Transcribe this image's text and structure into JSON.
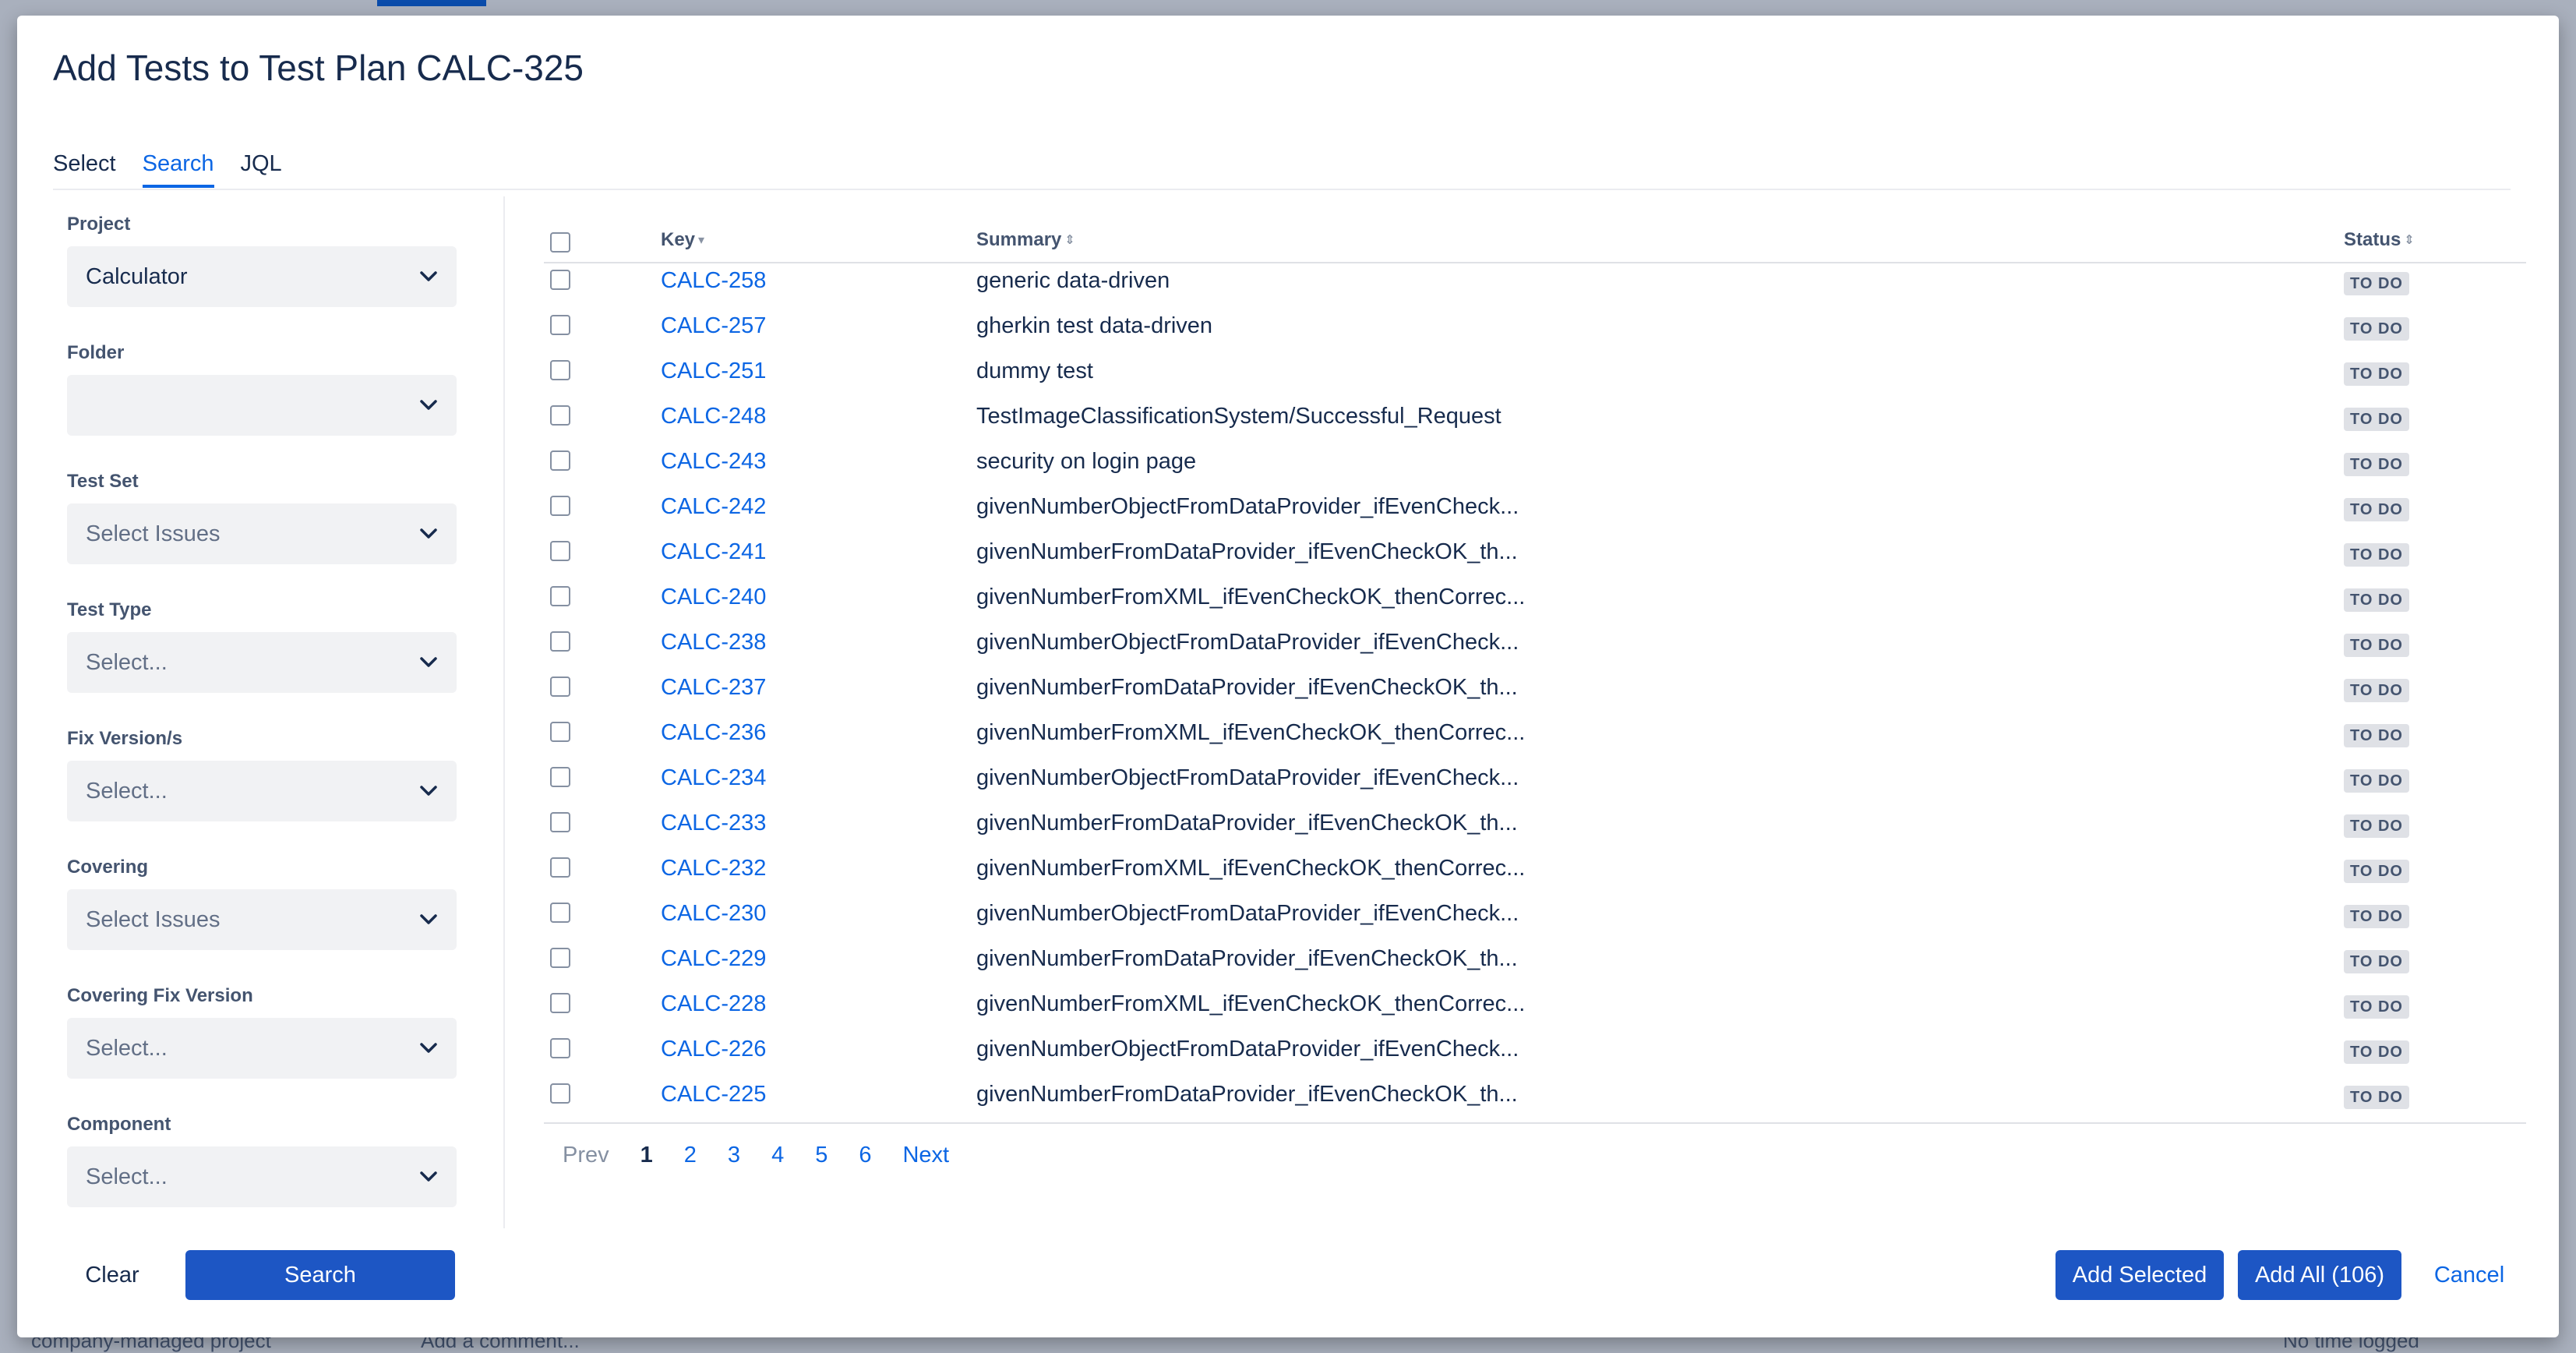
{
  "modal": {
    "title": "Add Tests to Test Plan CALC-325"
  },
  "tabs": [
    {
      "label": "Select",
      "active": false
    },
    {
      "label": "Search",
      "active": true
    },
    {
      "label": "JQL",
      "active": false
    }
  ],
  "filters": {
    "project": {
      "label": "Project",
      "value": "Calculator"
    },
    "folder": {
      "label": "Folder",
      "value": ""
    },
    "test_set": {
      "label": "Test Set",
      "placeholder": "Select Issues"
    },
    "test_type": {
      "label": "Test Type",
      "placeholder": "Select..."
    },
    "fix_version": {
      "label": "Fix Version/s",
      "placeholder": "Select..."
    },
    "covering": {
      "label": "Covering",
      "placeholder": "Select Issues"
    },
    "covering_fix_version": {
      "label": "Covering Fix Version",
      "placeholder": "Select..."
    },
    "component": {
      "label": "Component",
      "placeholder": "Select..."
    }
  },
  "table": {
    "columns": {
      "key": "Key",
      "summary": "Summary",
      "status": "Status"
    },
    "rows": [
      {
        "key": "CALC-258",
        "summary": "generic data-driven",
        "status": "TO DO"
      },
      {
        "key": "CALC-257",
        "summary": "gherkin test data-driven",
        "status": "TO DO"
      },
      {
        "key": "CALC-251",
        "summary": "dummy test",
        "status": "TO DO"
      },
      {
        "key": "CALC-248",
        "summary": "TestImageClassificationSystem/Successful_Request",
        "status": "TO DO"
      },
      {
        "key": "CALC-243",
        "summary": "security on login page",
        "status": "TO DO"
      },
      {
        "key": "CALC-242",
        "summary": "givenNumberObjectFromDataProvider_ifEvenCheck...",
        "status": "TO DO"
      },
      {
        "key": "CALC-241",
        "summary": "givenNumberFromDataProvider_ifEvenCheckOK_th...",
        "status": "TO DO"
      },
      {
        "key": "CALC-240",
        "summary": "givenNumberFromXML_ifEvenCheckOK_thenCorrec...",
        "status": "TO DO"
      },
      {
        "key": "CALC-238",
        "summary": "givenNumberObjectFromDataProvider_ifEvenCheck...",
        "status": "TO DO"
      },
      {
        "key": "CALC-237",
        "summary": "givenNumberFromDataProvider_ifEvenCheckOK_th...",
        "status": "TO DO"
      },
      {
        "key": "CALC-236",
        "summary": "givenNumberFromXML_ifEvenCheckOK_thenCorrec...",
        "status": "TO DO"
      },
      {
        "key": "CALC-234",
        "summary": "givenNumberObjectFromDataProvider_ifEvenCheck...",
        "status": "TO DO"
      },
      {
        "key": "CALC-233",
        "summary": "givenNumberFromDataProvider_ifEvenCheckOK_th...",
        "status": "TO DO"
      },
      {
        "key": "CALC-232",
        "summary": "givenNumberFromXML_ifEvenCheckOK_thenCorrec...",
        "status": "TO DO"
      },
      {
        "key": "CALC-230",
        "summary": "givenNumberObjectFromDataProvider_ifEvenCheck...",
        "status": "TO DO"
      },
      {
        "key": "CALC-229",
        "summary": "givenNumberFromDataProvider_ifEvenCheckOK_th...",
        "status": "TO DO"
      },
      {
        "key": "CALC-228",
        "summary": "givenNumberFromXML_ifEvenCheckOK_thenCorrec...",
        "status": "TO DO"
      },
      {
        "key": "CALC-226",
        "summary": "givenNumberObjectFromDataProvider_ifEvenCheck...",
        "status": "TO DO"
      },
      {
        "key": "CALC-225",
        "summary": "givenNumberFromDataProvider_ifEvenCheckOK_th...",
        "status": "TO DO"
      }
    ]
  },
  "pagination": {
    "prev": "Prev",
    "pages": [
      "1",
      "2",
      "3",
      "4",
      "5",
      "6"
    ],
    "current": "1",
    "next": "Next"
  },
  "footer": {
    "clear_label": "Clear",
    "search_label": "Search",
    "add_selected_label": "Add Selected",
    "add_all_label": "Add All (106)",
    "cancel_label": "Cancel"
  },
  "background": {
    "comment_placeholder": "Add a comment...",
    "time_text": "No time logged",
    "project_text": "company-managed project"
  },
  "colors": {
    "primary": "#1d56c4",
    "link": "#0c66e4",
    "badge_bg": "#dfe1e6"
  },
  "icons": {
    "dropdown": "chevron-down-icon",
    "sort": "sort-icon"
  }
}
